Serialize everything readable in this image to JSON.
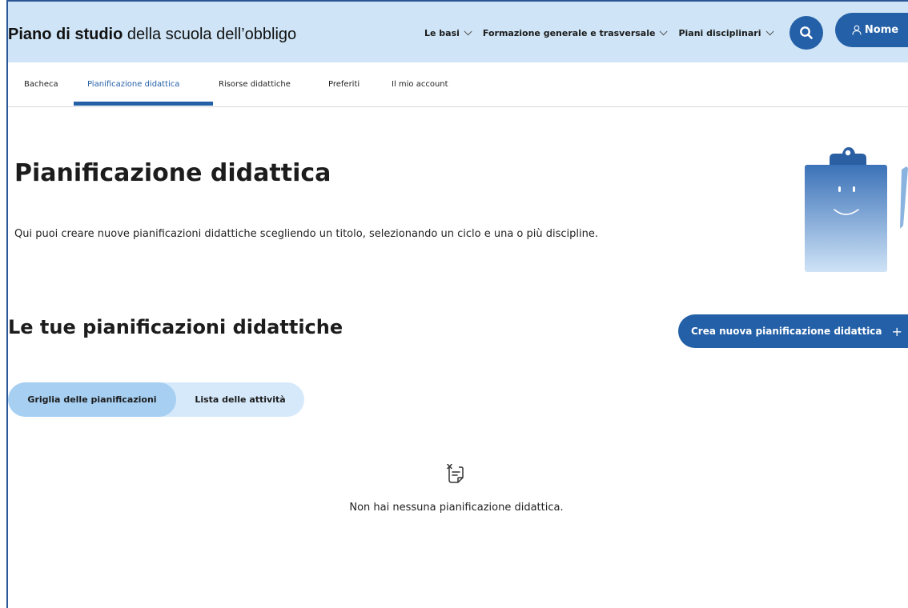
{
  "header": {
    "brand_strong": "Piano di studio",
    "brand_rest": "della scuola dell’obbligo",
    "nav": [
      {
        "label": "Le basi"
      },
      {
        "label": "Formazione generale e trasversale"
      },
      {
        "label": "Piani disciplinari"
      }
    ],
    "user_label": "Nome",
    "search_icon": "search-icon",
    "user_icon": "user-icon"
  },
  "subnav": {
    "tabs": [
      {
        "label": "Bacheca"
      },
      {
        "label": "Pianificazione didattica"
      },
      {
        "label": "Risorse didattiche"
      },
      {
        "label": "Preferiti"
      },
      {
        "label": "Il mio account"
      }
    ],
    "active_index": 1
  },
  "main": {
    "title": "Pianificazione didattica",
    "description": "Qui puoi creare nuove pianificazioni didattiche scegliendo un titolo, selezionando un ciclo e una o più discipline.",
    "section_title": "Le tue pianificazioni didattiche",
    "create_button": "Crea nuova pianificazione didattica",
    "view_toggle": [
      {
        "label": "Griglia delle pianificazioni",
        "selected": true
      },
      {
        "label": "Lista delle attività",
        "selected": false
      }
    ],
    "empty_message": "Non hai nessuna pianificazione didattica.",
    "empty_icon": "empty-note-icon"
  },
  "colors": {
    "accent": "#2460a7",
    "header_bg": "#cfe5f7",
    "toggle_bg": "#d6e9fa",
    "toggle_active": "#a6cff2"
  }
}
